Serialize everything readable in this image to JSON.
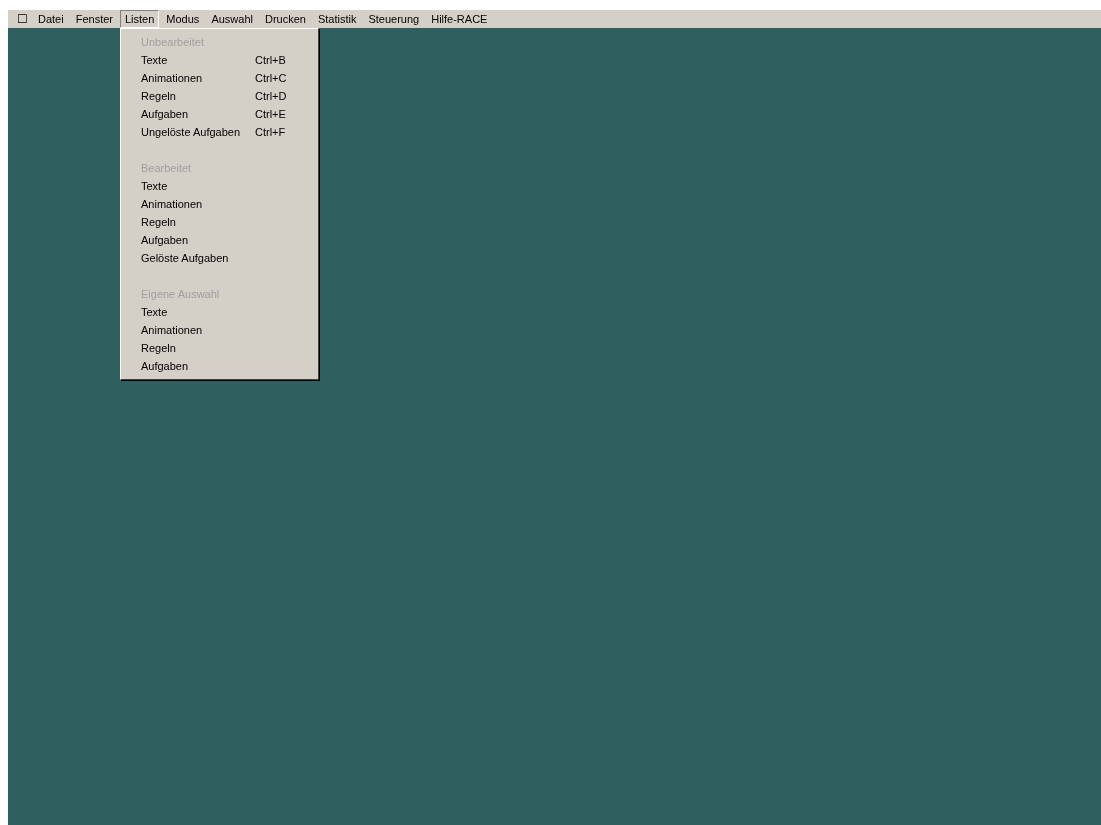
{
  "menu_bar": {
    "system_icon": "☐",
    "items": [
      {
        "label": "Datei",
        "selected": false
      },
      {
        "label": "Fenster",
        "selected": false
      },
      {
        "label": "Listen",
        "selected": true
      },
      {
        "label": "Modus",
        "selected": false
      },
      {
        "label": "Auswahl",
        "selected": false
      },
      {
        "label": "Drucken",
        "selected": false
      },
      {
        "label": "Statistik",
        "selected": false
      },
      {
        "label": "Steuerung",
        "selected": false
      },
      {
        "label": "Hilfe-RACE",
        "selected": false
      }
    ]
  },
  "dropdown": {
    "sections": [
      {
        "title": "Unbearbeitet",
        "items": [
          {
            "label": "Texte",
            "shortcut": "Ctrl+B"
          },
          {
            "label": "Animationen",
            "shortcut": "Ctrl+C"
          },
          {
            "label": "Regeln",
            "shortcut": "Ctrl+D"
          },
          {
            "label": "Aufgaben",
            "shortcut": "Ctrl+E"
          },
          {
            "label": "Ungelöste Aufgaben",
            "shortcut": "Ctrl+F"
          }
        ]
      },
      {
        "title": "Bearbeitet",
        "items": [
          {
            "label": "Texte"
          },
          {
            "label": "Animationen"
          },
          {
            "label": "Regeln"
          },
          {
            "label": "Aufgaben"
          },
          {
            "label": "Gelöste Aufgaben"
          }
        ]
      },
      {
        "title": "Eigene Auswahl",
        "items": [
          {
            "label": "Texte"
          },
          {
            "label": "Animationen"
          },
          {
            "label": "Regeln"
          },
          {
            "label": "Aufgaben"
          }
        ]
      }
    ]
  }
}
